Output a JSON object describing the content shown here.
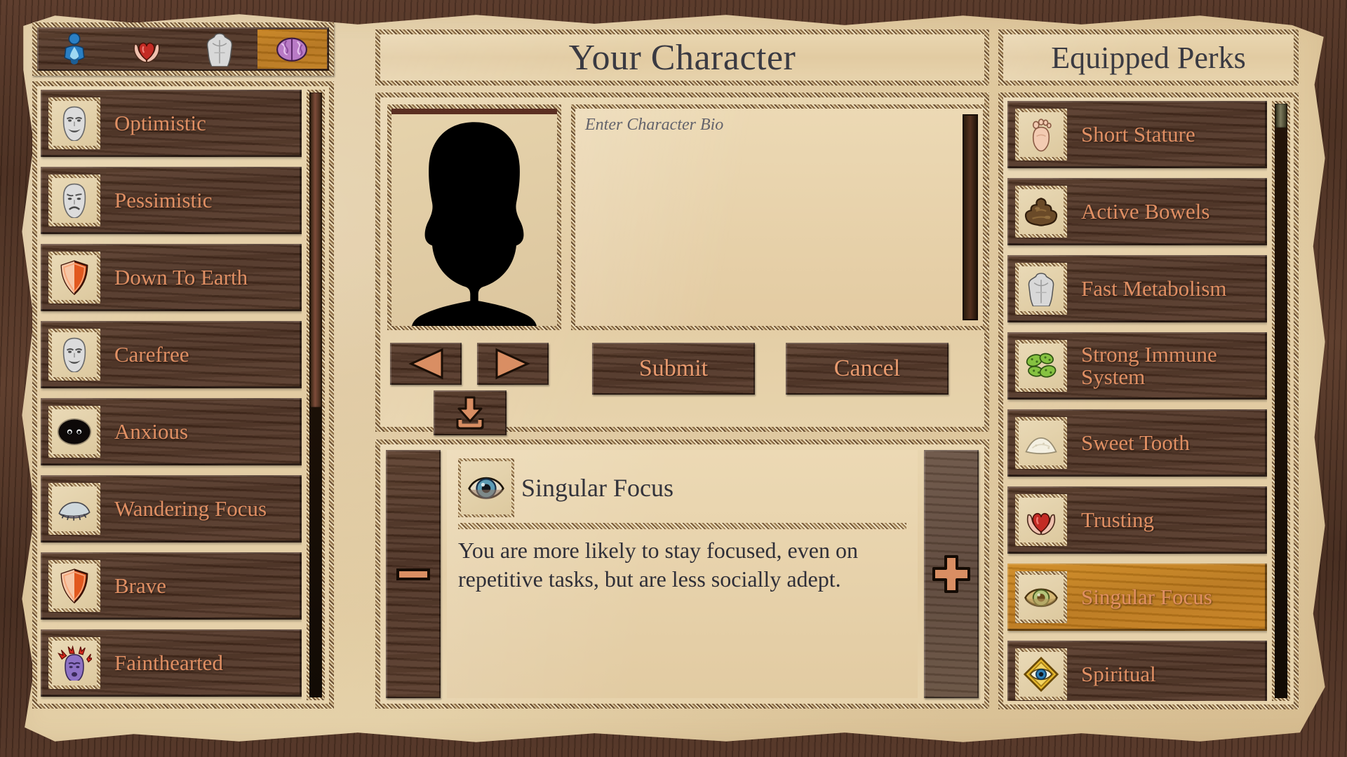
{
  "window": {
    "title": "Your Character"
  },
  "tabs": [
    {
      "id": "hydration",
      "icon": "blue-figure-droplet-icon",
      "selected": false
    },
    {
      "id": "social",
      "icon": "hands-heart-icon",
      "selected": false
    },
    {
      "id": "body",
      "icon": "torso-icon",
      "selected": false
    },
    {
      "id": "mind",
      "icon": "brain-icon",
      "selected": true
    }
  ],
  "trait_list": {
    "scrollbar": {
      "thumb_top_pct": 0,
      "thumb_height_pct": 52
    },
    "items": [
      {
        "label": "Optimistic",
        "icon": "smiling-mask-icon",
        "selected": false
      },
      {
        "label": "Pessimistic",
        "icon": "sad-mask-icon",
        "selected": false
      },
      {
        "label": "Down To Earth",
        "icon": "shield-icon",
        "selected": false
      },
      {
        "label": "Carefree",
        "icon": "smiling-mask-icon",
        "selected": false
      },
      {
        "label": "Anxious",
        "icon": "dark-blob-eyes-icon",
        "selected": false
      },
      {
        "label": "Wandering Focus",
        "icon": "closed-eye-icon",
        "selected": false
      },
      {
        "label": "Brave",
        "icon": "shield-icon",
        "selected": false
      },
      {
        "label": "Fainthearted",
        "icon": "shocked-purple-mask-icon",
        "selected": false
      }
    ]
  },
  "character": {
    "portrait_alt": "character-silhouette",
    "bio": {
      "value": "",
      "placeholder": "Enter Character Bio"
    },
    "prev_label": "◀",
    "next_label": "▶",
    "save_icon": "download-save-icon",
    "submit_label": "Submit",
    "cancel_label": "Cancel"
  },
  "detail": {
    "icon": "blue-eye-icon",
    "title": "Singular Focus",
    "description": "You are more likely to stay focused, even on repetitive tasks, but are less socially adept.",
    "remove_label": "−",
    "add_label": "+"
  },
  "perks": {
    "title": "Equipped Perks",
    "scrollbar": {
      "thumb_top_pct": 0,
      "thumb_height_pct": 4
    },
    "items": [
      {
        "label": "Short Stature",
        "icon": "foot-icon",
        "selected": false
      },
      {
        "label": "Active Bowels",
        "icon": "poop-icon",
        "selected": false
      },
      {
        "label": "Fast Metabolism",
        "icon": "torso-icon",
        "selected": false
      },
      {
        "label": "Strong Immune System",
        "icon": "green-germs-icon",
        "selected": false
      },
      {
        "label": "Sweet Tooth",
        "icon": "sugar-pile-icon",
        "selected": false
      },
      {
        "label": "Trusting",
        "icon": "hands-heart-icon",
        "selected": false
      },
      {
        "label": "Singular Focus",
        "icon": "gold-eye-icon",
        "selected": true
      },
      {
        "label": "Spiritual",
        "icon": "all-seeing-eye-icon",
        "selected": false
      }
    ]
  },
  "colors": {
    "accent_orange": "#e08f63",
    "selected_amber": "#c8801e",
    "wood_dark": "#4b2f20",
    "parchment": "#e4cfa6",
    "ink": "#33333b"
  }
}
